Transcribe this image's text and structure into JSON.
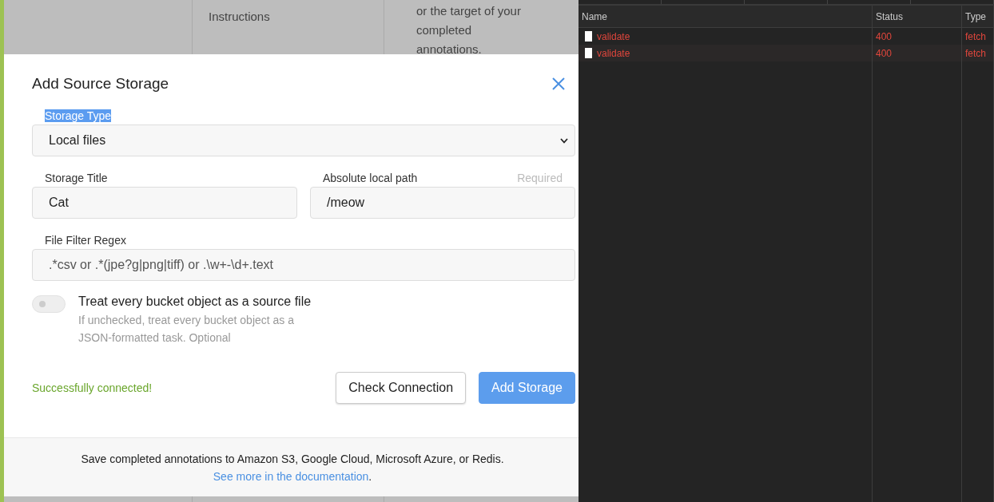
{
  "background_page": {
    "nav_items": [
      "Instructions"
    ],
    "description_lines": [
      "or the target of your",
      "completed",
      "annotations."
    ]
  },
  "modal": {
    "title": "Add Source Storage",
    "storage_type": {
      "label": "Storage Type",
      "label_highlighted": true,
      "value": "Local files"
    },
    "fields": [
      {
        "label": "Storage Title",
        "value": "Cat"
      },
      {
        "label": "Absolute local path",
        "value": "/meow",
        "required_note": "Required"
      }
    ],
    "file_filter": {
      "label": "File Filter Regex",
      "placeholder": ".*csv or .*(jpe?g|png|tiff) or .\\w+-\\d+.text"
    },
    "toggle": {
      "label": "Treat every bucket object as a source file",
      "on": false,
      "help": "If unchecked, treat every bucket object as a JSON-formatted task. Optional"
    },
    "status": "Successfully connected!",
    "buttons": [
      {
        "label": "Check Connection",
        "kind": "secondary"
      },
      {
        "label": "Add Storage",
        "kind": "primary"
      }
    ],
    "footer": {
      "text": "Save completed annotations to Amazon S3, Google Cloud, Microsoft Azure, or Redis.",
      "link": "See more in the documentation",
      "after_link": "."
    }
  },
  "devtools": {
    "columns": [
      "Name",
      "Status",
      "Type"
    ],
    "rows": [
      {
        "name": "validate",
        "status": "400",
        "type": "fetch",
        "error": true
      },
      {
        "name": "validate",
        "status": "400",
        "type": "fetch",
        "error": true
      }
    ]
  }
}
